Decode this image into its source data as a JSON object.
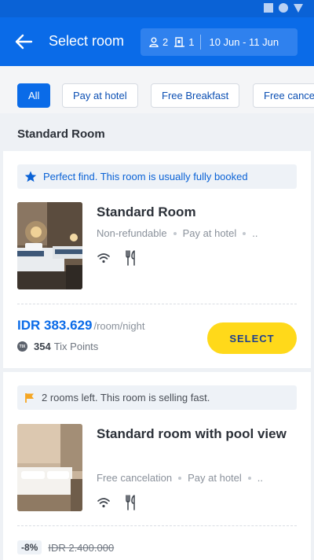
{
  "header": {
    "title": "Select room",
    "guests": "2",
    "rooms": "1",
    "dates": "10 Jun - 11 Jun"
  },
  "filters": [
    "All",
    "Pay at hotel",
    "Free Breakfast",
    "Free cancelation"
  ],
  "section_title": "Standard Room",
  "rooms": [
    {
      "notice": "Perfect find. This room is usually fully booked",
      "name": "Standard Room",
      "attrs": [
        "Non-refundable",
        "Pay at hotel",
        ".."
      ],
      "price": "IDR 383.629",
      "per_night": "/room/night",
      "tix_coin": "TIX",
      "points_value": "354",
      "points_label": "Tix Points",
      "select_label": "SELECT"
    },
    {
      "notice": "2 rooms left. This room is selling fast.",
      "name": "Standard room with pool view",
      "attrs": [
        "Free cancelation",
        "Pay at hotel",
        ".."
      ],
      "discount": "-8%",
      "original_price": "IDR 2.400.000"
    }
  ],
  "colors": {
    "primary": "#0a6be8",
    "select_button": "#ffd91a",
    "notice_flag": "#f5a623"
  }
}
